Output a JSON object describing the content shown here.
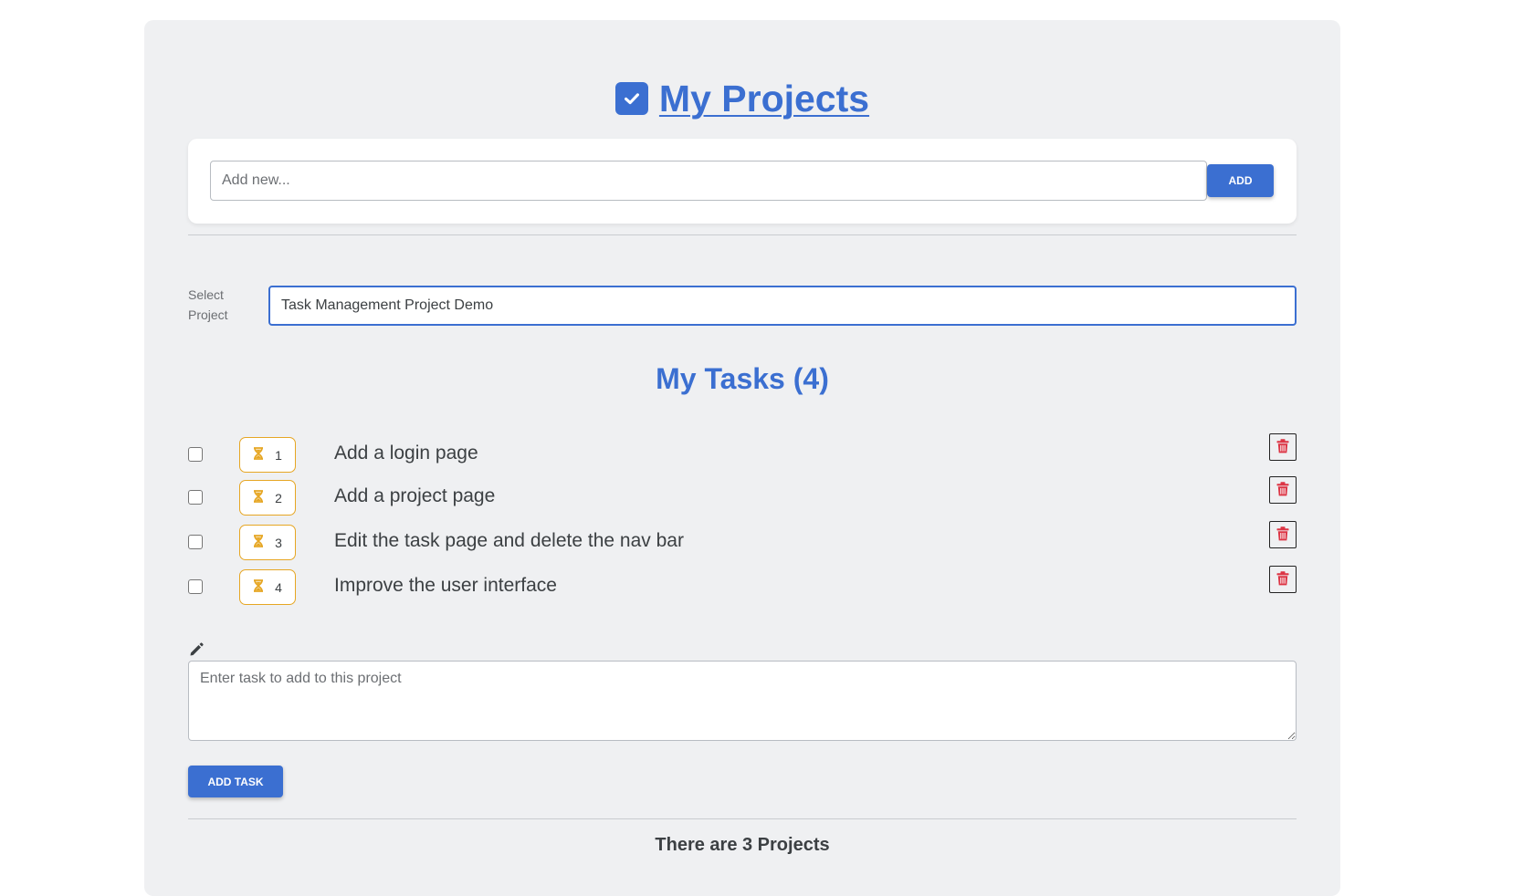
{
  "header": {
    "title": "My Projects",
    "icon": "check-square-icon",
    "accent_color": "#3b6fd1"
  },
  "new_project": {
    "placeholder": "Add new...",
    "value": "",
    "add_label": "ADD"
  },
  "project_select": {
    "label": "Select Project",
    "value": "Task Management Project Demo"
  },
  "tasks": {
    "heading": "My Tasks (4)",
    "status_icon": "hourglass-icon",
    "delete_icon": "trash-icon",
    "badge_color": "#e6a623",
    "delete_color": "#dc3545",
    "items": [
      {
        "number": "1",
        "text": "Add a login page",
        "done": false
      },
      {
        "number": "2",
        "text": "Add a project page",
        "done": false
      },
      {
        "number": "3",
        "text": "Edit the task page and delete the nav bar",
        "done": false
      },
      {
        "number": "4",
        "text": "Improve the user interface",
        "done": false
      }
    ]
  },
  "new_task": {
    "icon": "pencil-icon",
    "placeholder": "Enter task to add to this project",
    "value": "",
    "button_label": "ADD TASK"
  },
  "footer": {
    "projects_count_text": "There are 3 Projects"
  }
}
